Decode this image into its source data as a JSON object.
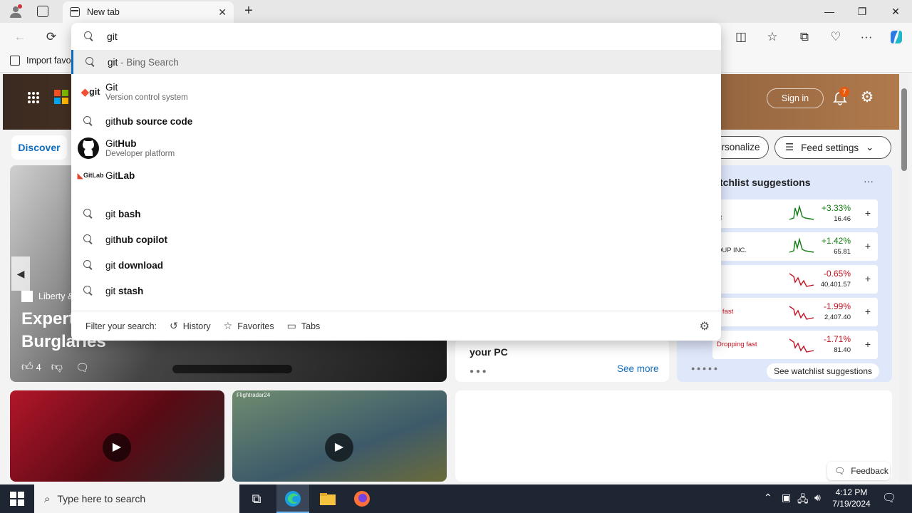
{
  "browser": {
    "tab_title": "New tab",
    "tab_close": "✕",
    "new_tab": "+",
    "window_controls": [
      "—",
      "❐",
      "✕"
    ],
    "favorites_bar": {
      "import_label": "Import favo"
    }
  },
  "omnibox": {
    "query": "git",
    "suggestions": [
      {
        "type": "search",
        "prefix": "git",
        "suffix": " - Bing Search",
        "highlighted": true
      },
      {
        "type": "entity",
        "icon": "git-logo",
        "icon_text": "git",
        "prefix": "Git",
        "bold": "",
        "sub": "Version control system"
      },
      {
        "type": "search",
        "prefix": "git",
        "bold": "hub source code"
      },
      {
        "type": "entity",
        "icon": "github-logo",
        "prefix": "Git",
        "bold": "Hub",
        "sub": "Developer platform"
      },
      {
        "type": "entity",
        "icon": "gitlab-logo",
        "icon_text": "GitLab",
        "prefix": "Git",
        "bold": "Lab"
      },
      {
        "type": "search",
        "prefix": "git ",
        "bold": "bash"
      },
      {
        "type": "search",
        "prefix": "git",
        "bold": "hub copilot"
      },
      {
        "type": "search",
        "prefix": "git ",
        "bold": "download"
      },
      {
        "type": "search",
        "prefix": "git ",
        "bold": "stash"
      }
    ],
    "filter": {
      "label": "Filter your search:",
      "chips": [
        "History",
        "Favorites",
        "Tabs"
      ]
    }
  },
  "page": {
    "sign_in": "Sign in",
    "notification_count": "7",
    "discover": "Discover",
    "personalize": "ersonalize",
    "feed_settings": "Feed settings",
    "hero_source": "Liberty &",
    "hero_title_line1": "Expert",
    "hero_title_line2": "Burglaries",
    "hero_likes": "4",
    "mid_card_text": "your PC",
    "see_more": "See more",
    "watchlist": {
      "title": "tchlist suggestions",
      "more": "···",
      "rows": [
        {
          "name": "st",
          "change": "+3.33%",
          "price": "16.46",
          "up": true
        },
        {
          "name": "OUP INC.",
          "change": "+1.42%",
          "price": "65.81",
          "up": true
        },
        {
          "name": "",
          "change": "-0.65%",
          "price": "40,401.57",
          "up": false
        },
        {
          "name": "g fast",
          "change": "-1.99%",
          "price": "2,407.40",
          "up": false
        },
        {
          "name": "Dropping fast",
          "change": "-1.71%",
          "price": "81.40",
          "up": false
        }
      ],
      "see_suggestions": "See watchlist suggestions"
    },
    "feedback": "Feedback",
    "video_source": "Flightradar24"
  },
  "taskbar": {
    "search_placeholder": "Type here to search",
    "time": "4:12 PM",
    "date": "7/19/2024"
  },
  "colors": {
    "accent": "#0f6cbd",
    "up": "#107c10",
    "down": "#c50f1f"
  }
}
